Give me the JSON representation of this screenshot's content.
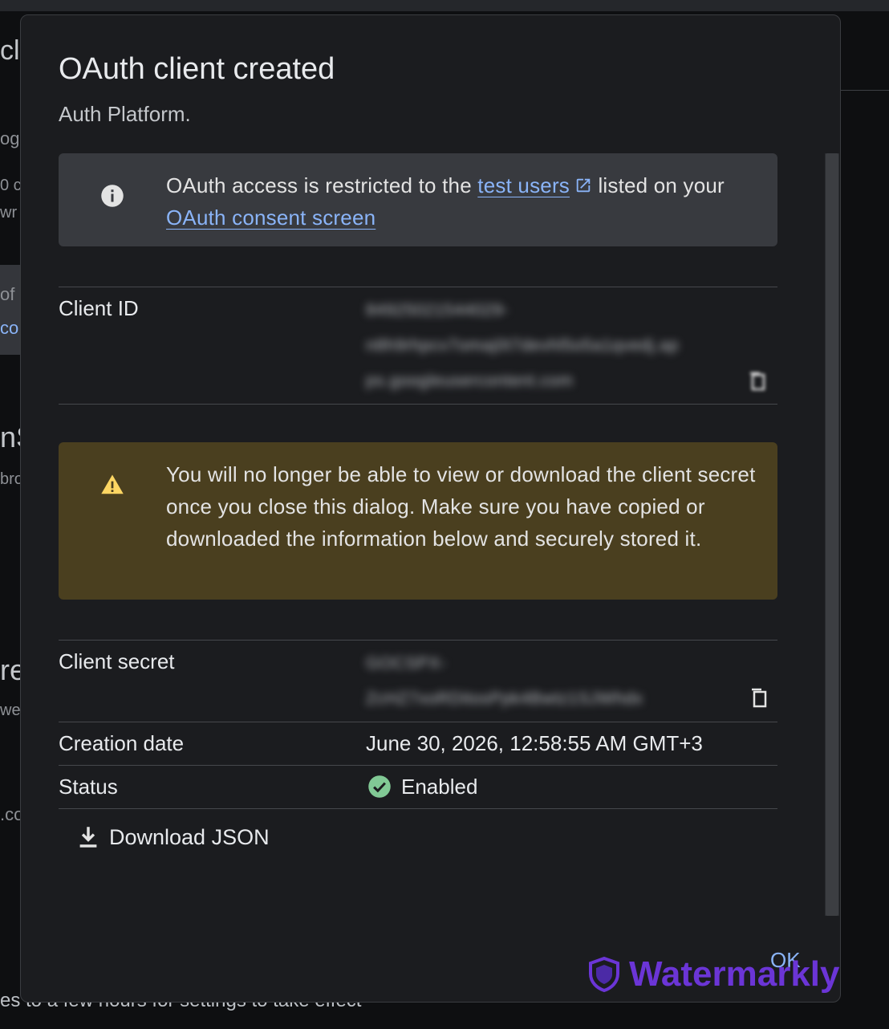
{
  "background": {
    "fragments": [
      "cl",
      "og",
      "0 c",
      "wr",
      "of",
      "co",
      "nS",
      "bro",
      "re",
      "we",
      ".co"
    ],
    "bottom_text": "es to a few hours for settings to take effect"
  },
  "dialog": {
    "title": "OAuth client created",
    "cut_off_text": "Auth Platform.",
    "info_notice": {
      "icon": "info-icon",
      "text_before": "OAuth access is restricted to the ",
      "link1": "test users",
      "text_middle": " listed on your ",
      "link2": "OAuth consent screen"
    },
    "client_id": {
      "label": "Client ID",
      "value_lines": [
        "84925021544029-",
        "n8h9rhpcv7omaj0t7devhl5o5a1qvedj.ap",
        "ps.googleusercontent.com"
      ]
    },
    "warning_notice": {
      "icon": "warning-icon",
      "text": "You will no longer be able to view or download the client secret once you close this dialog. Make sure you have copied or downloaded the information below and securely stored it."
    },
    "client_secret": {
      "label": "Client secret",
      "value_lines": [
        "GOCSPX-",
        "ZcHZ7xoRDitosPpk4Bwtz1SJWhdx"
      ]
    },
    "creation_date": {
      "label": "Creation date",
      "value": "June 30, 2026, 12:58:55 AM GMT+3"
    },
    "status": {
      "label": "Status",
      "value": "Enabled",
      "color": "#81c995"
    },
    "download_label": "Download JSON",
    "ok_label": "OK"
  },
  "watermark": {
    "text": "Watermarkly",
    "color": "#6b35d6"
  }
}
